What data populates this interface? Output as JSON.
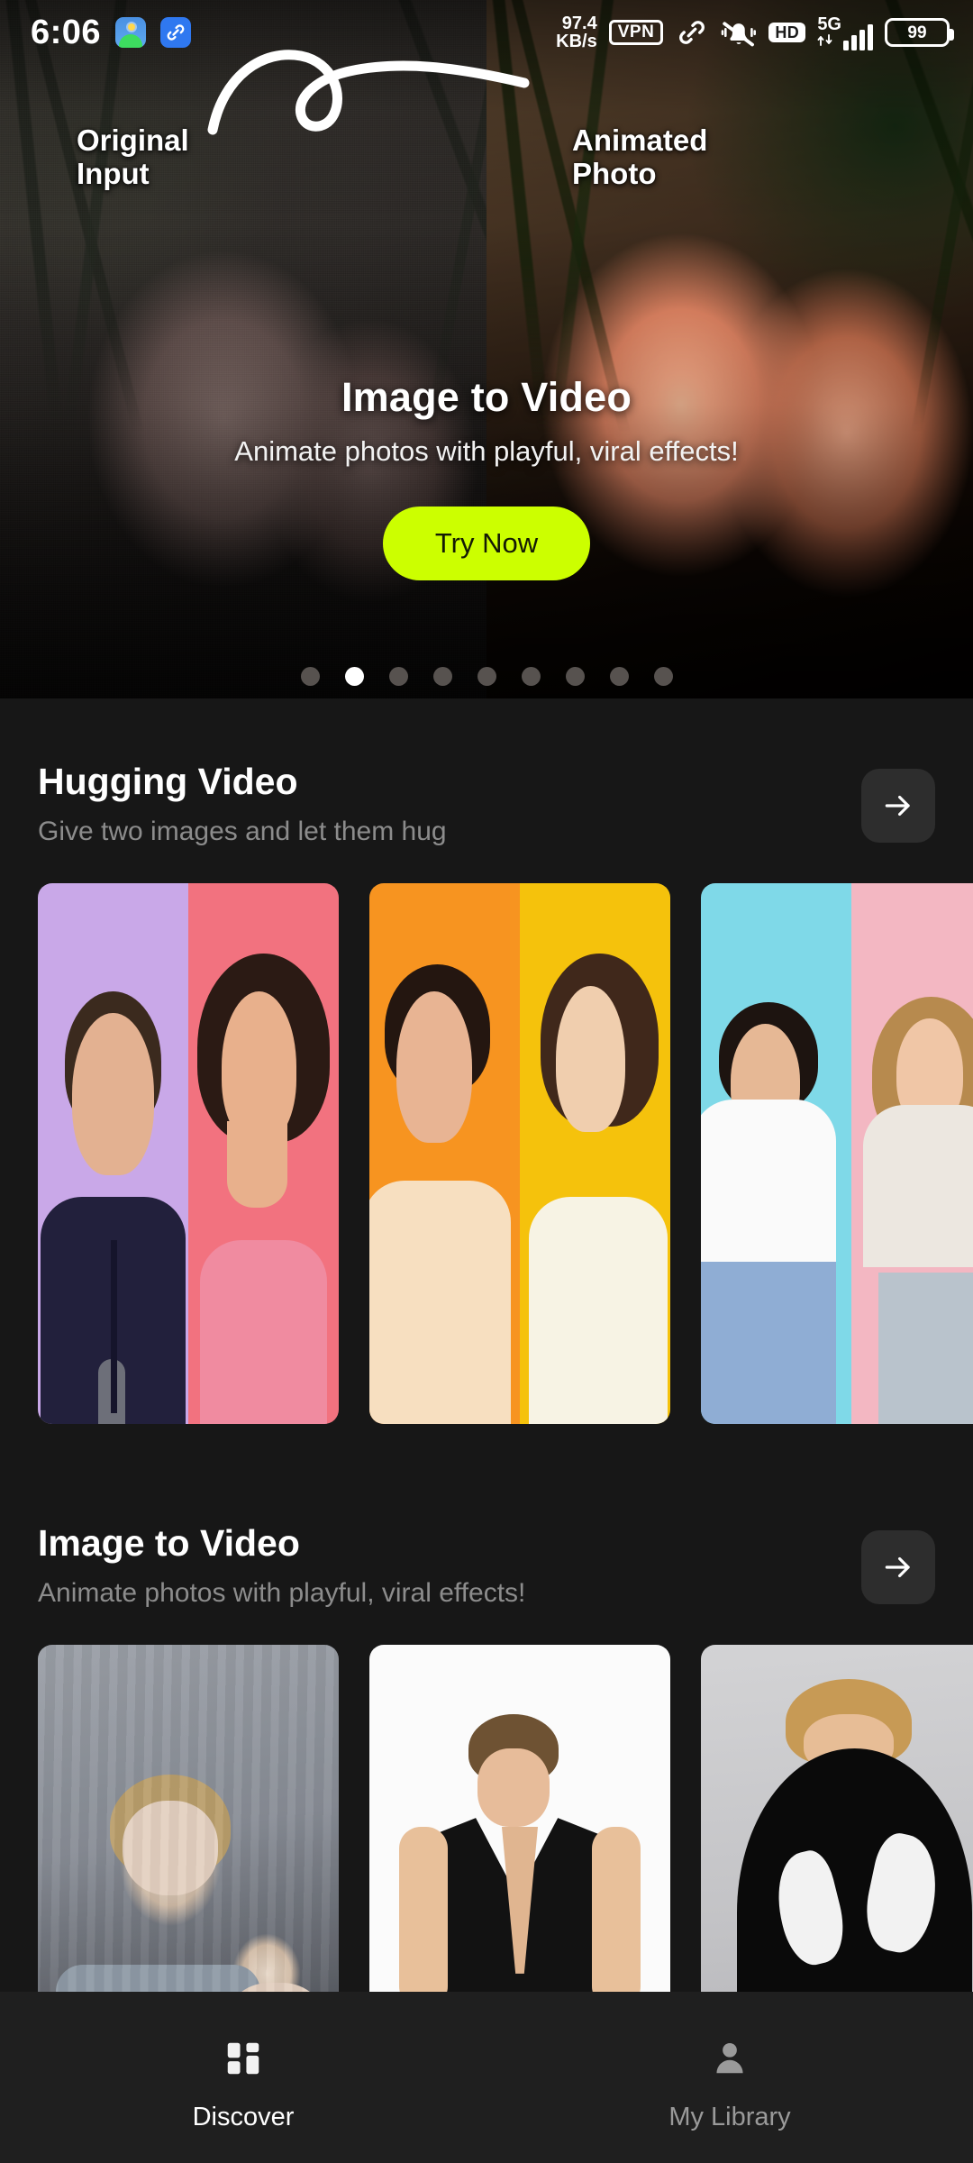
{
  "status_bar": {
    "time": "6:06",
    "app_icons": [
      "photos-icon",
      "link-icon"
    ],
    "net_speed_value": "97.4",
    "net_speed_unit": "KB/s",
    "vpn_label": "VPN",
    "silent_icon": "bell-muted-icon",
    "link_icon": "link-icon",
    "hd_label": "HD",
    "network_type": "5G",
    "signal_bars": 4,
    "battery_level": "99"
  },
  "hero": {
    "label_left": "Original\nInput",
    "label_left_line1": "Original",
    "label_left_line2": "Input",
    "label_right_line1": "Animated",
    "label_right_line2": "Photo",
    "title": "Image to Video",
    "subtitle": "Animate photos with playful, viral effects!",
    "cta_label": "Try Now",
    "cta_color": "#ccff00",
    "cta_text_color": "#141a05",
    "doodle": "loop-squiggle-icon",
    "pagination": {
      "total": 9,
      "active_index": 1
    }
  },
  "sections": [
    {
      "title": "Hugging Video",
      "subtitle": "Give two images and let them hug",
      "arrow_icon": "arrow-right-icon",
      "cards": [
        {
          "name": "man-purple-woman-pink",
          "left_bg": "#c9a8e8",
          "right_bg": "#f2727f",
          "left_outfit": "#22203c",
          "right_outfit": "#f08ba0"
        },
        {
          "name": "man-orange-woman-yellow",
          "left_bg": "#f79420",
          "right_bg": "#f5c20c",
          "left_outfit": "#f7dfc0",
          "right_outfit": "#f7f3e4"
        },
        {
          "name": "man-cyan-woman-pink",
          "left_bg": "#7fd9e8",
          "right_bg": "#f3b7c2",
          "left_outfit": "#fafafa",
          "right_outfit": "#ece7e0"
        }
      ]
    },
    {
      "title": "Image to Video",
      "subtitle": "Animate photos with playful, viral effects!",
      "arrow_icon": "arrow-right-icon",
      "cards": [
        {
          "name": "vintage-mother-and-baby"
        },
        {
          "name": "man-black-shirt-white-bg"
        },
        {
          "name": "venom-transformation"
        }
      ]
    }
  ],
  "bottom_nav": {
    "items": [
      {
        "label": "Discover",
        "icon": "grid-icon",
        "active": true
      },
      {
        "label": "My Library",
        "icon": "person-icon",
        "active": false
      }
    ]
  }
}
